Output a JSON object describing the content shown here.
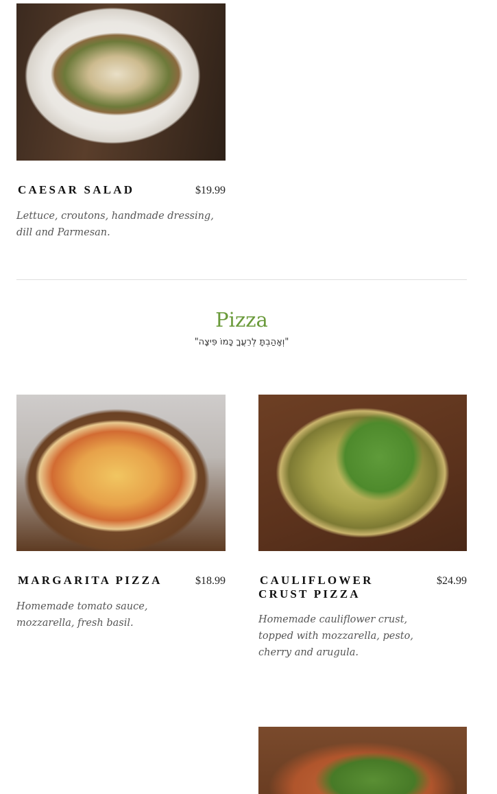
{
  "menu": {
    "caesar": {
      "name": "CAESAR SALAD",
      "price": "$19.99",
      "description": "Lettuce, croutons, handmade dressing,\ndill and Parmesan."
    },
    "section": {
      "title": "Pizza",
      "subtitle": "\"וְאָהַבְתָּ לְרֵעֲךָ כָּמוֹ פִּיצָה\""
    },
    "margarita": {
      "name": "MARGARITA PIZZA",
      "price": "$18.99",
      "description": "Homemade tomato sauce,\n mozzarella, fresh basil."
    },
    "cauliflower": {
      "name_line1": "CAULIFLOWER",
      "name_line2": "CRUST PIZZA",
      "price": "$24.99",
      "description": " Homemade cauliflower crust,\ntopped with  mozzarella, pesto,\ncherry and arugula."
    }
  },
  "colors": {
    "section_title": "#6a9a3a",
    "divider": "#dedede"
  },
  "images": {
    "caesar": "caesar-salad-photo",
    "margarita": "margarita-pizza-photo",
    "cauliflower": "cauliflower-crust-pizza-photo",
    "next_item": "pizza-photo"
  }
}
